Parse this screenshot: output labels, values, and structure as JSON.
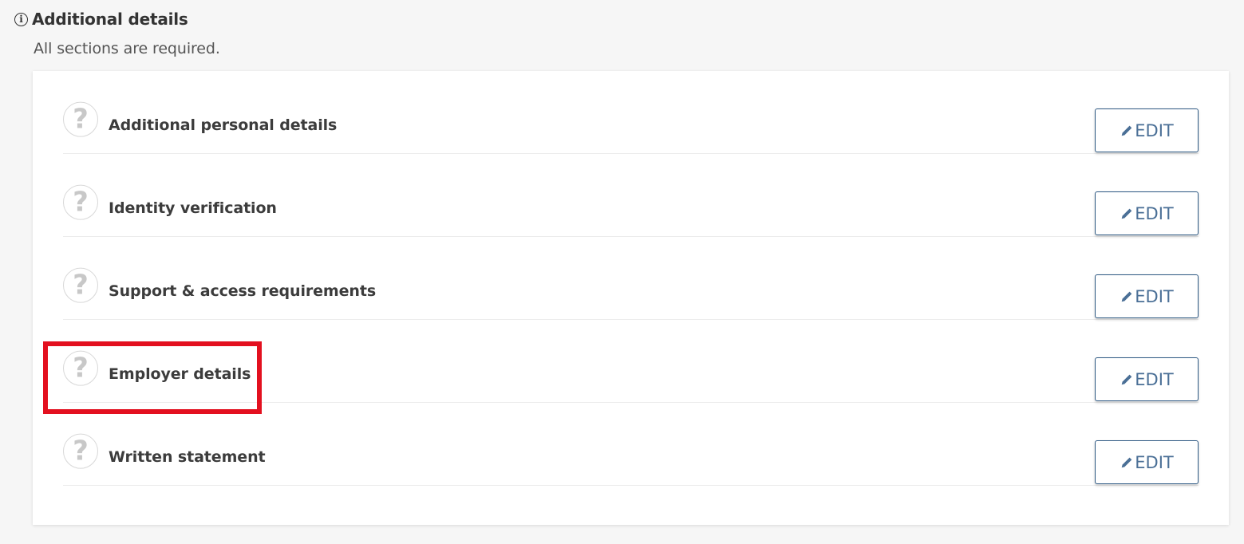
{
  "header": {
    "title": "Additional details",
    "subtitle": "All sections are required."
  },
  "sections": [
    {
      "label": "Additional personal details",
      "status_icon": "question-circle-icon",
      "button_label": "EDIT"
    },
    {
      "label": "Identity verification",
      "status_icon": "question-circle-icon",
      "button_label": "EDIT"
    },
    {
      "label": "Support & access requirements",
      "status_icon": "question-circle-icon",
      "button_label": "EDIT"
    },
    {
      "label": "Employer details",
      "status_icon": "question-circle-icon",
      "button_label": "EDIT"
    },
    {
      "label": "Written statement",
      "status_icon": "question-circle-icon",
      "button_label": "EDIT"
    }
  ],
  "colors": {
    "accent": "#4a6f96",
    "button_border": "#2f5a84",
    "highlight": "#e3101f",
    "background": "#f6f6f6"
  }
}
